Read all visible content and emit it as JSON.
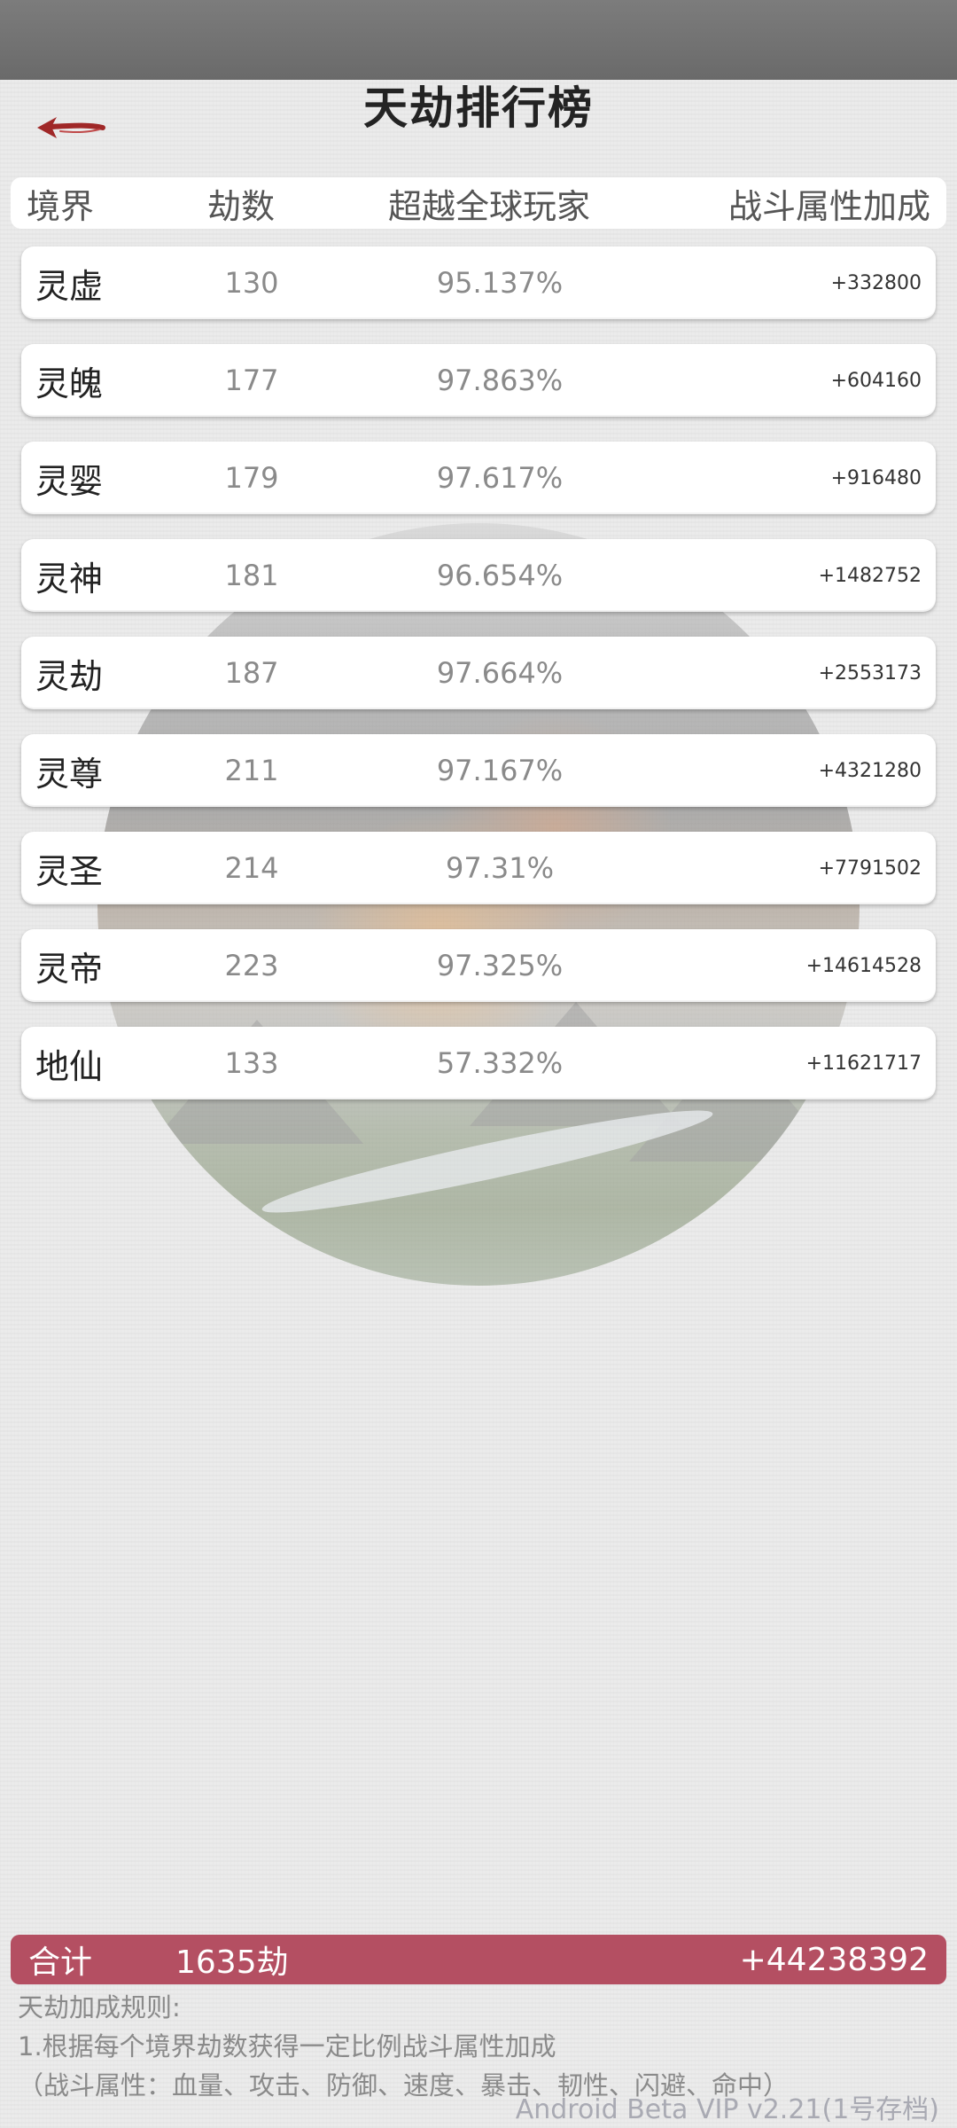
{
  "header": {
    "title": "天劫排行榜",
    "back_icon": "back-arrow-icon"
  },
  "table": {
    "columns": [
      "境界",
      "劫数",
      "超越全球玩家",
      "战斗属性加成"
    ],
    "rows": [
      {
        "realm": "灵虚",
        "count": "130",
        "percent": "95.137%",
        "bonus": "+332800"
      },
      {
        "realm": "灵魄",
        "count": "177",
        "percent": "97.863%",
        "bonus": "+604160"
      },
      {
        "realm": "灵婴",
        "count": "179",
        "percent": "97.617%",
        "bonus": "+916480"
      },
      {
        "realm": "灵神",
        "count": "181",
        "percent": "96.654%",
        "bonus": "+1482752"
      },
      {
        "realm": "灵劫",
        "count": "187",
        "percent": "97.664%",
        "bonus": "+2553173"
      },
      {
        "realm": "灵尊",
        "count": "211",
        "percent": "97.167%",
        "bonus": "+4321280"
      },
      {
        "realm": "灵圣",
        "count": "214",
        "percent": "97.31%",
        "bonus": "+7791502"
      },
      {
        "realm": "灵帝",
        "count": "223",
        "percent": "97.325%",
        "bonus": "+14614528"
      },
      {
        "realm": "地仙",
        "count": "133",
        "percent": "57.332%",
        "bonus": "+11621717"
      }
    ]
  },
  "total": {
    "label": "合计",
    "count": "1635劫",
    "bonus": "+44238392"
  },
  "rules": {
    "title": "天劫加成规则:",
    "line1": "1.根据每个境界劫数获得一定比例战斗属性加成",
    "line2": "（战斗属性：血量、攻击、防御、速度、暴击、韧性、闪避、命中）"
  },
  "version": "Android Beta VIP v2.21(1号存档)",
  "colors": {
    "accent": "#b44f62",
    "back_arrow": "#a02828",
    "status_bar": "#727272"
  }
}
